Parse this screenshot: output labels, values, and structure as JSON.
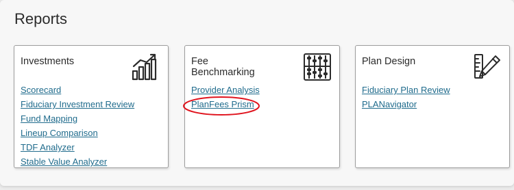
{
  "page": {
    "title": "Reports"
  },
  "cards": [
    {
      "title": "Investments",
      "icon": "bar-chart-icon",
      "links": [
        "Scorecard",
        "Fiduciary Investment Review",
        "Fund Mapping",
        "Lineup Comparison",
        "TDF Analyzer",
        "Stable Value Analyzer"
      ]
    },
    {
      "title": "Fee\nBenchmarking",
      "icon": "abacus-icon",
      "links": [
        "Provider Analysis",
        "PlanFees Prism"
      ]
    },
    {
      "title": "Plan Design",
      "icon": "pencil-ruler-icon",
      "links": [
        "Fiduciary Plan Review",
        "PLANavigator"
      ]
    }
  ],
  "annotation": {
    "color": "#e0141e",
    "target": "PlanFees Prism"
  },
  "colors": {
    "link": "#1f6b8c",
    "card_border": "#9c9c9c",
    "background": "#f7f7f7"
  }
}
